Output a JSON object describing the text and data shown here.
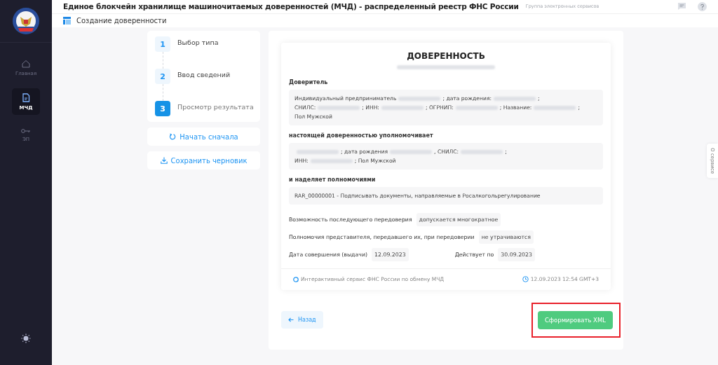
{
  "header": {
    "title": "Единое блокчейн хранилище машиночитаемых доверенностей (МЧД) - распределенный реестр ФНС России",
    "subtitle": "Группа электронных сервисов"
  },
  "page_title": "Создание доверенности",
  "sidebar": {
    "items": [
      {
        "label": "Главная",
        "selected": false
      },
      {
        "label": "МЧД",
        "selected": true
      },
      {
        "label": "ЭП",
        "selected": false
      }
    ]
  },
  "steps": [
    {
      "number": "1",
      "label": "Выбор типа",
      "selected": false
    },
    {
      "number": "2",
      "label": "Ввод сведений",
      "selected": false
    },
    {
      "number": "3",
      "label": "Просмотр результата",
      "selected": true
    }
  ],
  "side_buttons": [
    "Начать сначала",
    "Сохранить черновик"
  ],
  "document": {
    "title": "ДОВЕРЕННОСТЬ",
    "sections": [
      {
        "heading": "Доверитель",
        "parts": [
          {
            "kind": "text",
            "text": "Индивидуальный предприниматель"
          },
          {
            "kind": "redacted"
          },
          {
            "kind": "text",
            "text": "; дата рождения:"
          },
          {
            "kind": "redacted"
          },
          {
            "kind": "text",
            "text": ";"
          },
          {
            "kind": "break"
          },
          {
            "kind": "text",
            "text": "СНИЛС:"
          },
          {
            "kind": "redacted"
          },
          {
            "kind": "text",
            "text": "; ИНН:"
          },
          {
            "kind": "redacted"
          },
          {
            "kind": "text",
            "text": "; ОГРНИП:"
          },
          {
            "kind": "redacted"
          },
          {
            "kind": "text",
            "text": "; Название:"
          },
          {
            "kind": "redacted"
          },
          {
            "kind": "text",
            "text": ";"
          },
          {
            "kind": "break"
          },
          {
            "kind": "text",
            "text": "Пол Мужской"
          }
        ]
      },
      {
        "heading": "настоящей доверенностью уполномочивает",
        "parts": [
          {
            "kind": "redacted"
          },
          {
            "kind": "text",
            "text": "; дата рождения"
          },
          {
            "kind": "redacted"
          },
          {
            "kind": "text",
            "text": ", СНИЛС:"
          },
          {
            "kind": "redacted"
          },
          {
            "kind": "text",
            "text": ";"
          },
          {
            "kind": "break"
          },
          {
            "kind": "text",
            "text": "ИНН:"
          },
          {
            "kind": "redacted"
          },
          {
            "kind": "text",
            "text": "; Пол Мужской"
          }
        ]
      },
      {
        "heading": "и наделяет полномочиями",
        "parts": [
          {
            "kind": "text",
            "text": "RAR_00000001 - Подписывать документы, направляемые в Росалкогольрегулирование"
          }
        ]
      }
    ],
    "fields": [
      [
        {
          "label": "Возможность последующего передоверия",
          "value": "допускается многократное"
        }
      ],
      [
        {
          "label": "Полномочия представителя, передавшего их, при передоверии",
          "value": "не утрачиваются"
        }
      ],
      [
        {
          "label": "Дата совершения (выдачи)",
          "value": "12.09.2023"
        },
        {
          "label": "Действует по",
          "value": "30.09.2023"
        }
      ]
    ],
    "footer_left": "Интерактивный сервис ФНС России по обмену МЧД",
    "footer_right": "12.09.2023 12:54 GMT+3"
  },
  "back_button": "Назад",
  "submit_button": {
    "label": "Сформировать XML",
    "highlighted": true
  },
  "side_tab": "О сервисе"
}
